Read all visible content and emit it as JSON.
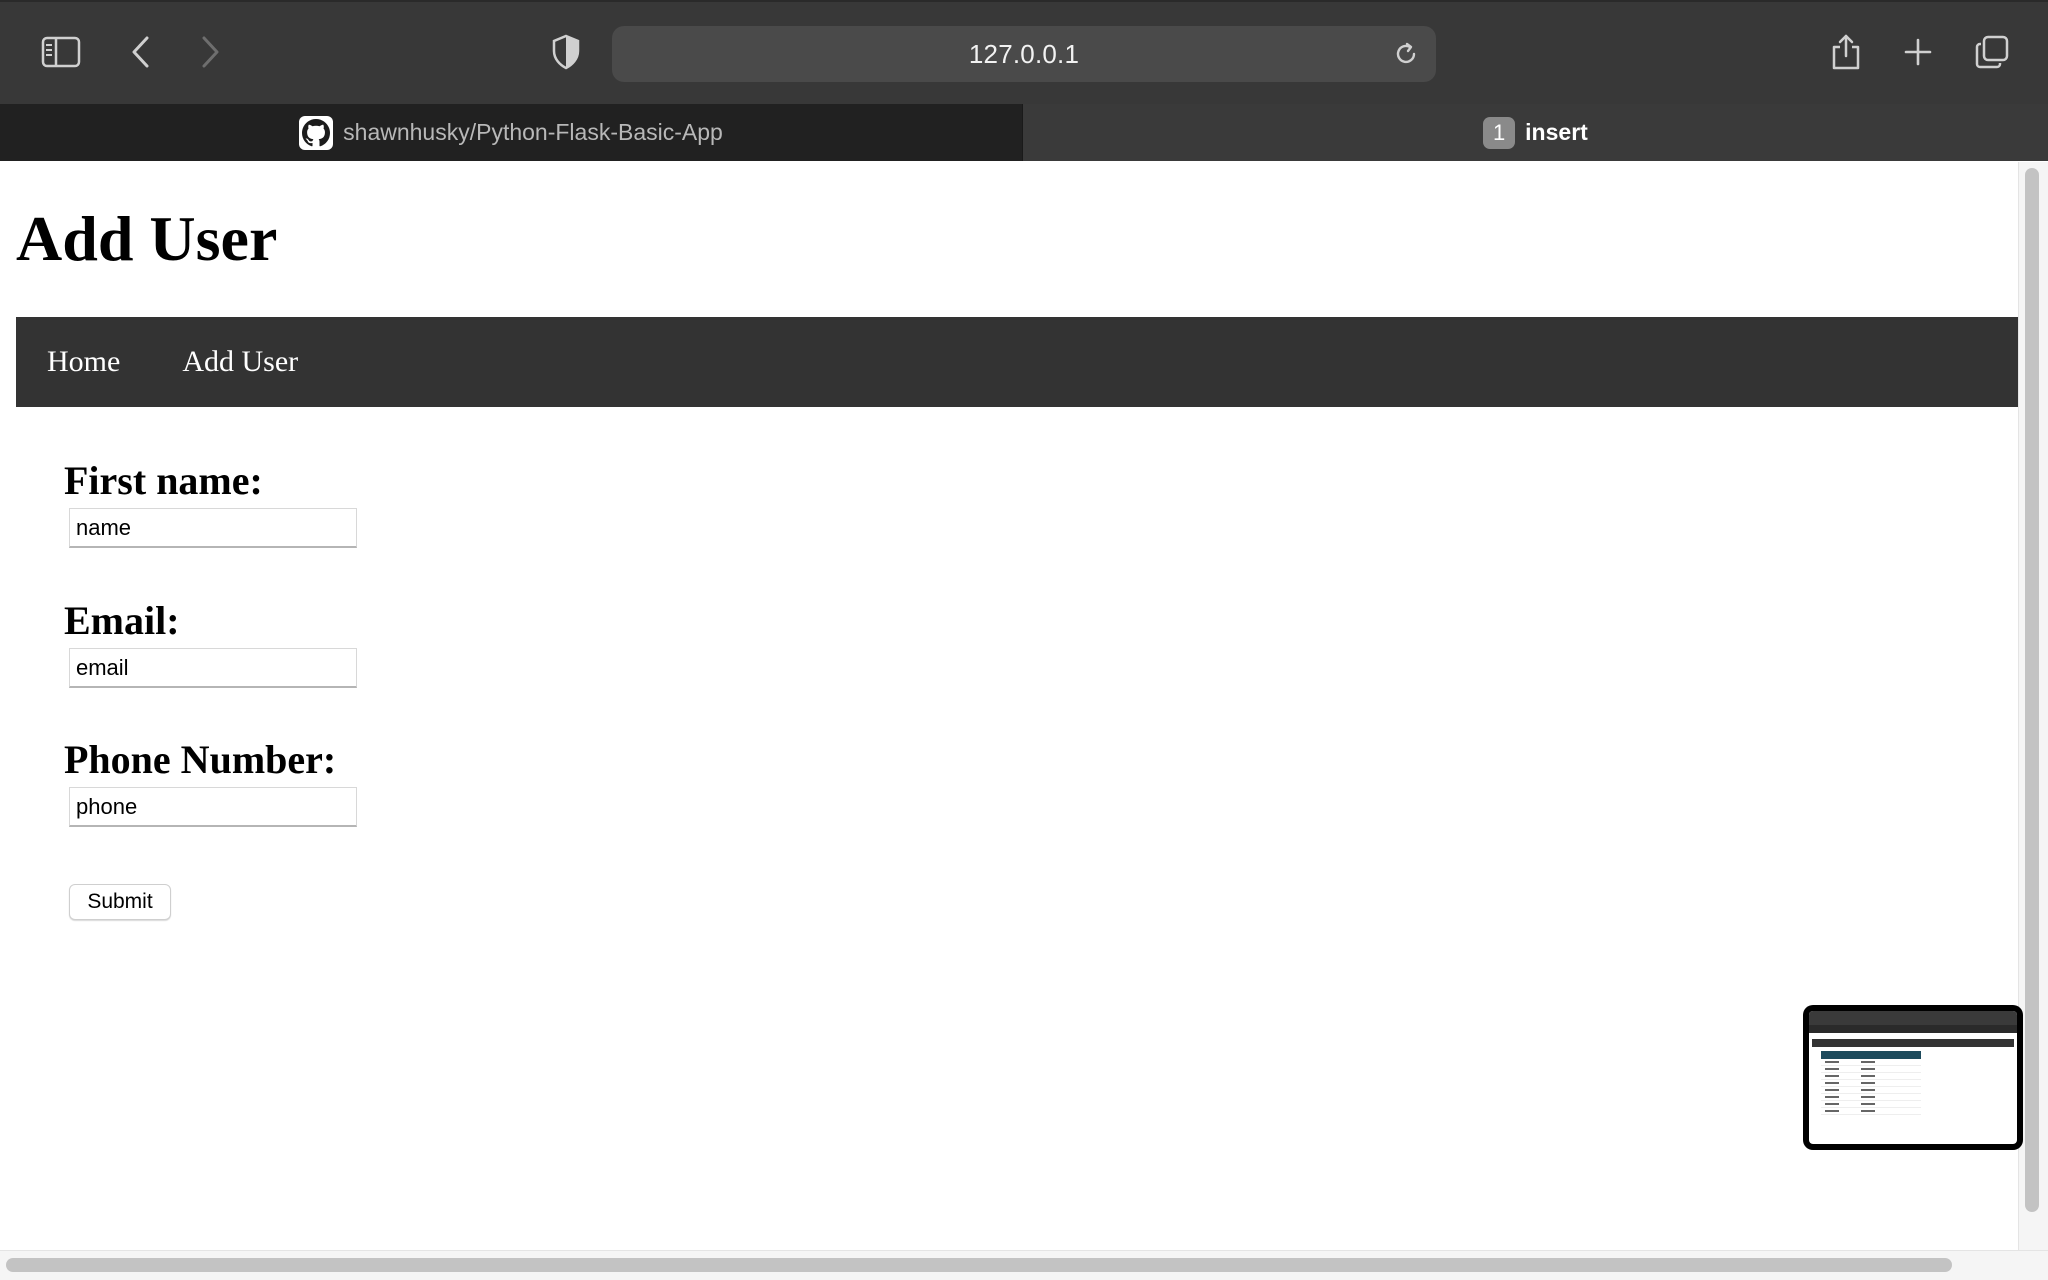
{
  "browser": {
    "url": "127.0.0.1",
    "tabs": [
      {
        "label": "shawnhusky/Python-Flask-Basic-App",
        "icon": "github-icon"
      },
      {
        "label": "insert",
        "badge": "1"
      }
    ],
    "colors": {
      "toolbar": "#383838",
      "active_tab": "#3a3a3a",
      "inactive_tab": "#212121"
    }
  },
  "page": {
    "title": "Add User",
    "nav": [
      {
        "label": "Home"
      },
      {
        "label": "Add User"
      }
    ],
    "nav_color": "#333333",
    "form": {
      "first_name_label": "First name:",
      "first_name_value": "name",
      "email_label": "Email:",
      "email_value": "email",
      "phone_label": "Phone Number:",
      "phone_value": "phone",
      "submit_label": "Submit"
    }
  }
}
